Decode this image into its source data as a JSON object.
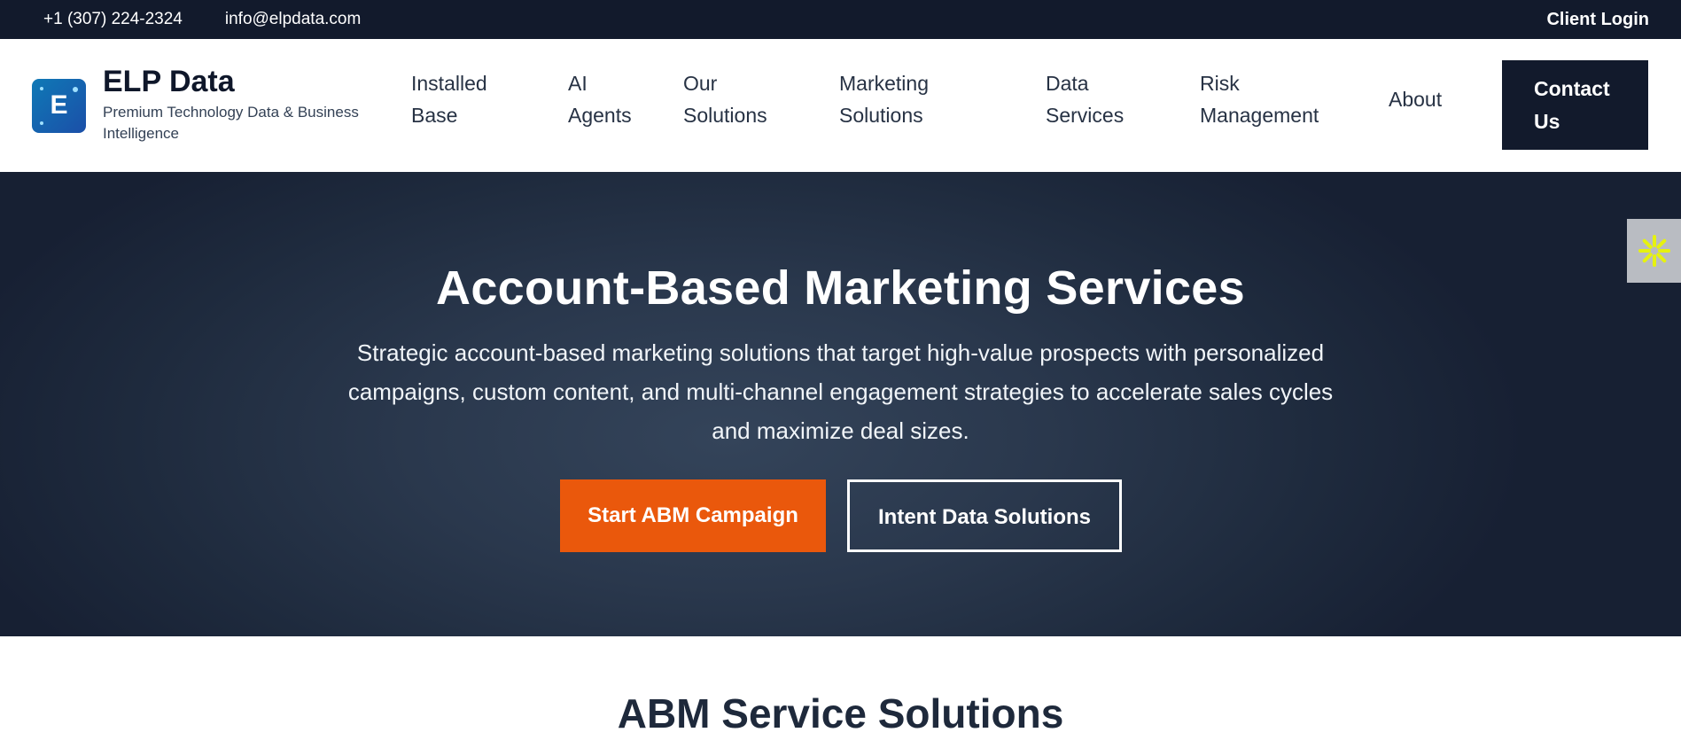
{
  "topbar": {
    "phone": "+1 (307) 224-2324",
    "email": "info@elpdata.com",
    "login": "Client Login"
  },
  "brand": {
    "logo_letter": "E",
    "name": "ELP Data",
    "tagline": "Premium Technology Data & Business Intelligence"
  },
  "nav": {
    "items": [
      {
        "line1": "Installed",
        "line2": "Base"
      },
      {
        "line1": "AI",
        "line2": "Agents"
      },
      {
        "line1": "Our",
        "line2": "Solutions"
      },
      {
        "line1": "Marketing",
        "line2": "Solutions"
      },
      {
        "line1": "Data",
        "line2": "Services"
      },
      {
        "line1": "Risk",
        "line2": "Management"
      },
      {
        "line1": "About",
        "line2": ""
      }
    ],
    "contact_line1": "Contact",
    "contact_line2": "Us"
  },
  "hero": {
    "title": "Account-Based Marketing Services",
    "description": "Strategic account-based marketing solutions that target high-value prospects with personalized campaigns, custom content, and multi-channel engagement strategies to accelerate sales cycles and maximize deal sizes.",
    "primary_cta": "Start ABM Campaign",
    "secondary_cta": "Intent Data Solutions"
  },
  "section": {
    "title": "ABM Service Solutions"
  },
  "colors": {
    "dark_navy": "#121a2c",
    "accent_orange": "#ea580c",
    "widget_icon": "#e6f20f"
  },
  "icons": {
    "widget": "asterisk-sparkle-icon"
  }
}
